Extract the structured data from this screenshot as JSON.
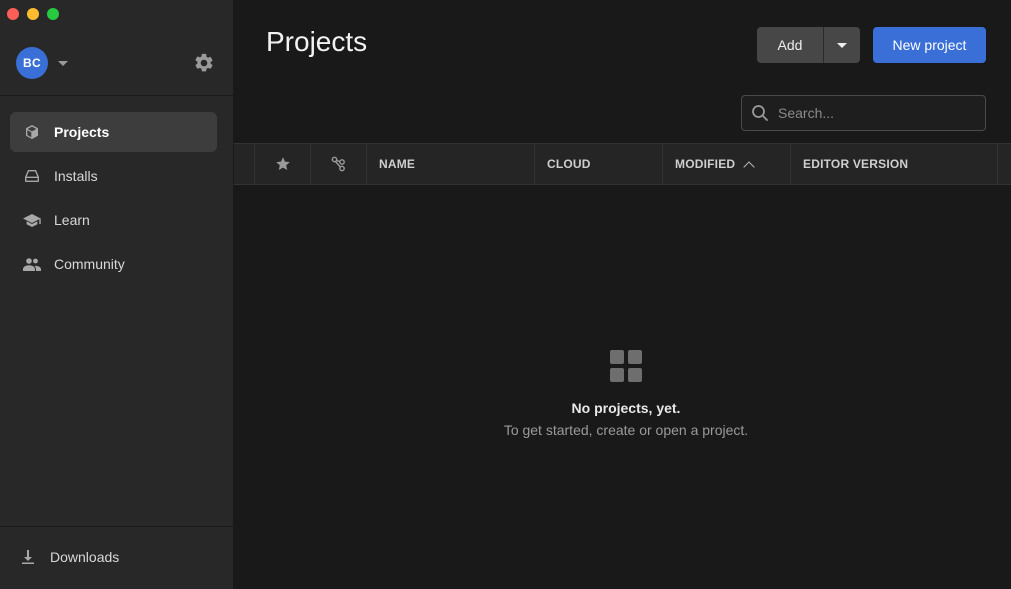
{
  "window": {
    "controls": [
      "close",
      "minimize",
      "maximize"
    ]
  },
  "account": {
    "initials": "BC",
    "avatar_color": "#3a6fd8"
  },
  "sidebar": {
    "items": [
      {
        "label": "Projects",
        "icon": "cube-icon",
        "active": true
      },
      {
        "label": "Installs",
        "icon": "drive-icon",
        "active": false
      },
      {
        "label": "Learn",
        "icon": "graduation-cap-icon",
        "active": false
      },
      {
        "label": "Community",
        "icon": "people-icon",
        "active": false
      }
    ],
    "downloads_label": "Downloads"
  },
  "header": {
    "title": "Projects",
    "add_label": "Add",
    "new_project_label": "New project"
  },
  "search": {
    "placeholder": "Search..."
  },
  "table": {
    "columns": [
      "NAME",
      "CLOUD",
      "MODIFIED",
      "EDITOR VERSION"
    ],
    "sorted_column": "MODIFIED",
    "sort_direction": "ascending"
  },
  "empty_state": {
    "title": "No projects, yet.",
    "subtitle": "To get started, create or open a project."
  },
  "colors": {
    "accent": "#3a6fd8",
    "sidebar_bg": "#282828",
    "main_bg": "#191919"
  }
}
